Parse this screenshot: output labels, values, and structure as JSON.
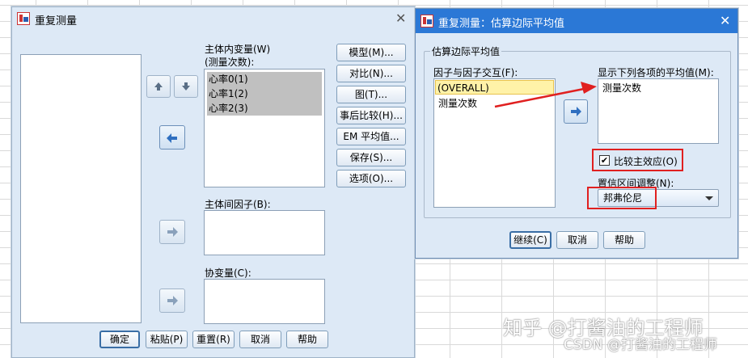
{
  "left_dialog": {
    "title": "重复测量",
    "within_label": "主体内变量(W)",
    "within_sublabel": "(测量次数):",
    "within_items": [
      "心率0(1)",
      "心率1(2)",
      "心率2(3)"
    ],
    "between_label": "主体间因子(B):",
    "covariate_label": "协变量(C):",
    "side_buttons": [
      "模型(M)...",
      "对比(N)...",
      "图(T)...",
      "事后比较(H)...",
      "EM 平均值...",
      "保存(S)...",
      "选项(O)..."
    ],
    "bottom_buttons": [
      "确定",
      "粘贴(P)",
      "重置(R)",
      "取消",
      "帮助"
    ]
  },
  "right_dialog": {
    "title": "重复测量：估算边际平均值",
    "group_label": "估算边际平均值",
    "factors_label": "因子与因子交互(F):",
    "factors_items": [
      "(OVERALL)",
      "测量次数"
    ],
    "display_label": "显示下列各项的平均值(M):",
    "display_items": [
      "测量次数"
    ],
    "compare_label": "比较主效应(O)",
    "compare_checked": true,
    "ci_label": "置信区间调整(N):",
    "ci_value": "邦弗伦尼",
    "buttons": [
      "继续(C)",
      "取消",
      "帮助"
    ]
  },
  "watermark": {
    "line1": "知乎 @打酱油的工程师",
    "line2": "CSDN @打酱油的工程师"
  },
  "colors": {
    "dialog_bg": "#dde9f6",
    "highlight_red": "#e02020",
    "selection_gray": "#c0c0c0",
    "selection_yellow": "#fff2a8"
  }
}
